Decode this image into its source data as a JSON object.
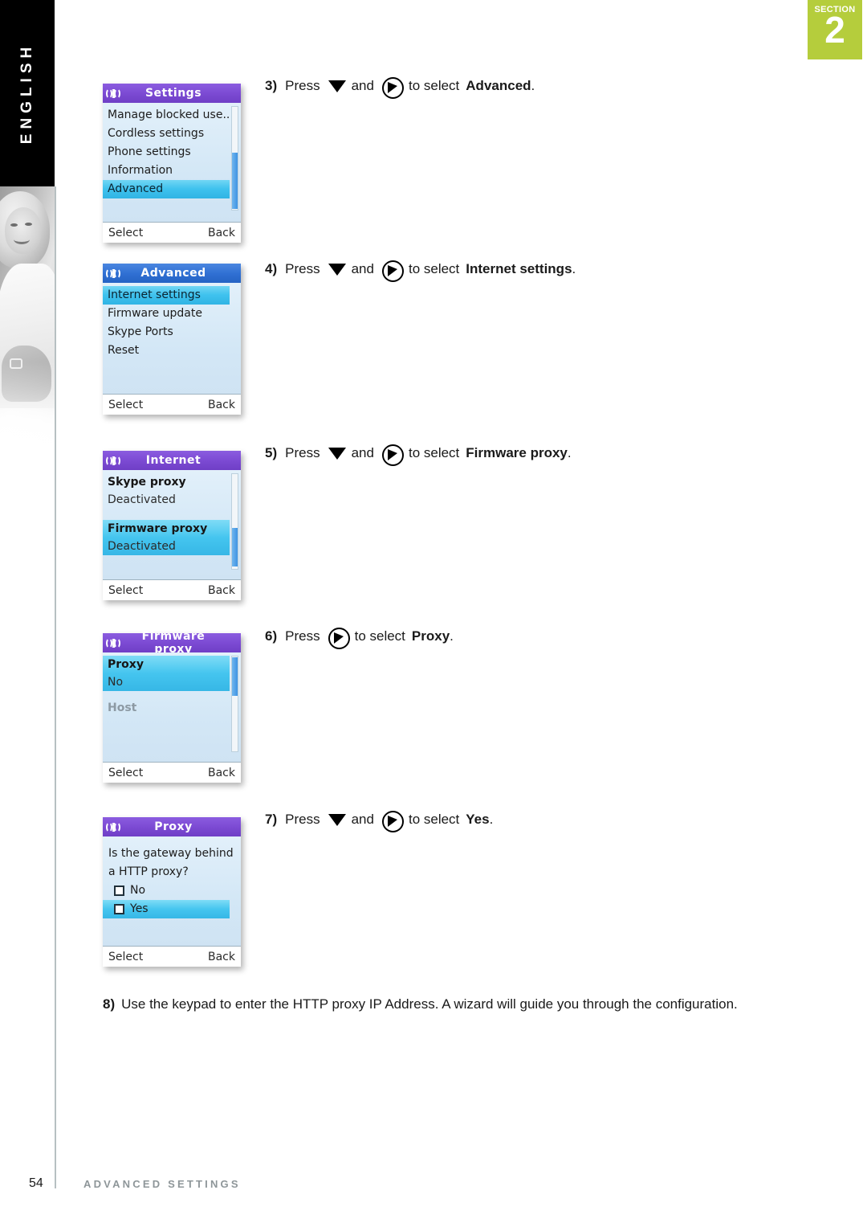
{
  "sidebar": {
    "language_tab": "ENGLISH",
    "photo_alt": "smiling-woman-photo"
  },
  "section_badge": {
    "word": "SECTION",
    "number": "2",
    "color": "#b5cd3c"
  },
  "footer": {
    "page_number": "54",
    "title": "ADVANCED SETTINGS"
  },
  "softkeys": {
    "left": "Select",
    "right": "Back"
  },
  "steps": [
    {
      "number": "3)",
      "press": "Press",
      "icons": [
        "down-arrow-icon",
        "select-key-icon"
      ],
      "and": "and",
      "to_select": "to select",
      "target": "Advanced",
      "period": "."
    },
    {
      "number": "4)",
      "press": "Press",
      "icons": [
        "down-arrow-icon",
        "select-key-icon"
      ],
      "and": "and",
      "to_select": "to select",
      "target": "Internet settings",
      "period": "."
    },
    {
      "number": "5)",
      "press": "Press",
      "icons": [
        "down-arrow-icon",
        "select-key-icon"
      ],
      "and": "and",
      "to_select": "to select",
      "target": "Firmware proxy",
      "period": "."
    },
    {
      "number": "6)",
      "press": "Press",
      "icons": [
        "select-key-icon"
      ],
      "and": "",
      "to_select": "to select",
      "target": "Proxy",
      "period": "."
    },
    {
      "number": "7)",
      "press": "Press",
      "icons": [
        "down-arrow-icon",
        "select-key-icon"
      ],
      "and": "and",
      "to_select": "to select",
      "target": "Yes",
      "period": "."
    }
  ],
  "step8": {
    "number": "8)",
    "text": "Use the keypad to enter the HTTP proxy IP Address. A wizard will guide you through the configuration."
  },
  "screens": {
    "settings": {
      "title": "Settings",
      "title_color": "#7b49d2",
      "items": [
        "Manage blocked use..",
        "Cordless settings",
        "Phone settings",
        "Information",
        "Advanced"
      ],
      "selected_index": 4
    },
    "advanced": {
      "title": "Advanced",
      "title_color": "#2f6fd2",
      "items": [
        "Internet settings",
        "Firmware update",
        "Skype Ports",
        "Reset"
      ],
      "selected_index": 0
    },
    "internet": {
      "title": "Internet",
      "title_color": "#7b49d2",
      "pairs": [
        {
          "label": "Skype proxy",
          "value": "Deactivated"
        },
        {
          "label": "Firmware proxy",
          "value": "Deactivated"
        }
      ],
      "selected_index": 1
    },
    "firmware_proxy": {
      "title": "Firmware proxy",
      "title_color": "#7b49d2",
      "pairs": [
        {
          "label": "Proxy",
          "value": "No"
        },
        {
          "label": "Host",
          "value": ""
        }
      ],
      "selected_index": 0
    },
    "proxy": {
      "title": "Proxy",
      "title_color": "#7b49d2",
      "question_line1": "Is the gateway behind",
      "question_line2": "a HTTP proxy?",
      "options": [
        "No",
        "Yes"
      ],
      "selected_index": 1
    }
  }
}
